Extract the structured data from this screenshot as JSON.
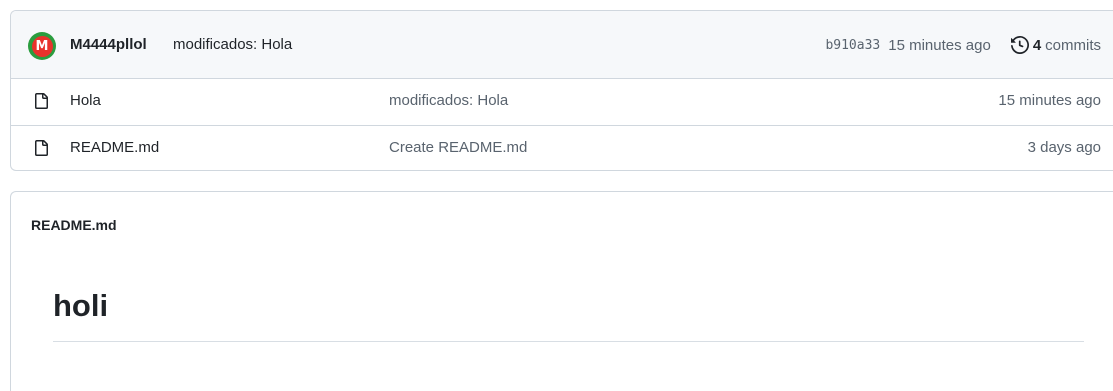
{
  "latest_commit": {
    "author": "M4444pllol",
    "message": "modificados: Hola",
    "sha": "b910a33",
    "time": "15 minutes ago",
    "commit_count": "4",
    "commits_label": "commits",
    "avatar_letter": "M"
  },
  "files": [
    {
      "name": "Hola",
      "commit_message": "modificados: Hola",
      "time": "15 minutes ago",
      "icon": "file-icon"
    },
    {
      "name": "README.md",
      "commit_message": "Create README.md",
      "time": "3 days ago",
      "icon": "file-icon"
    }
  ],
  "readme": {
    "header": "README.md",
    "title": "holi"
  }
}
